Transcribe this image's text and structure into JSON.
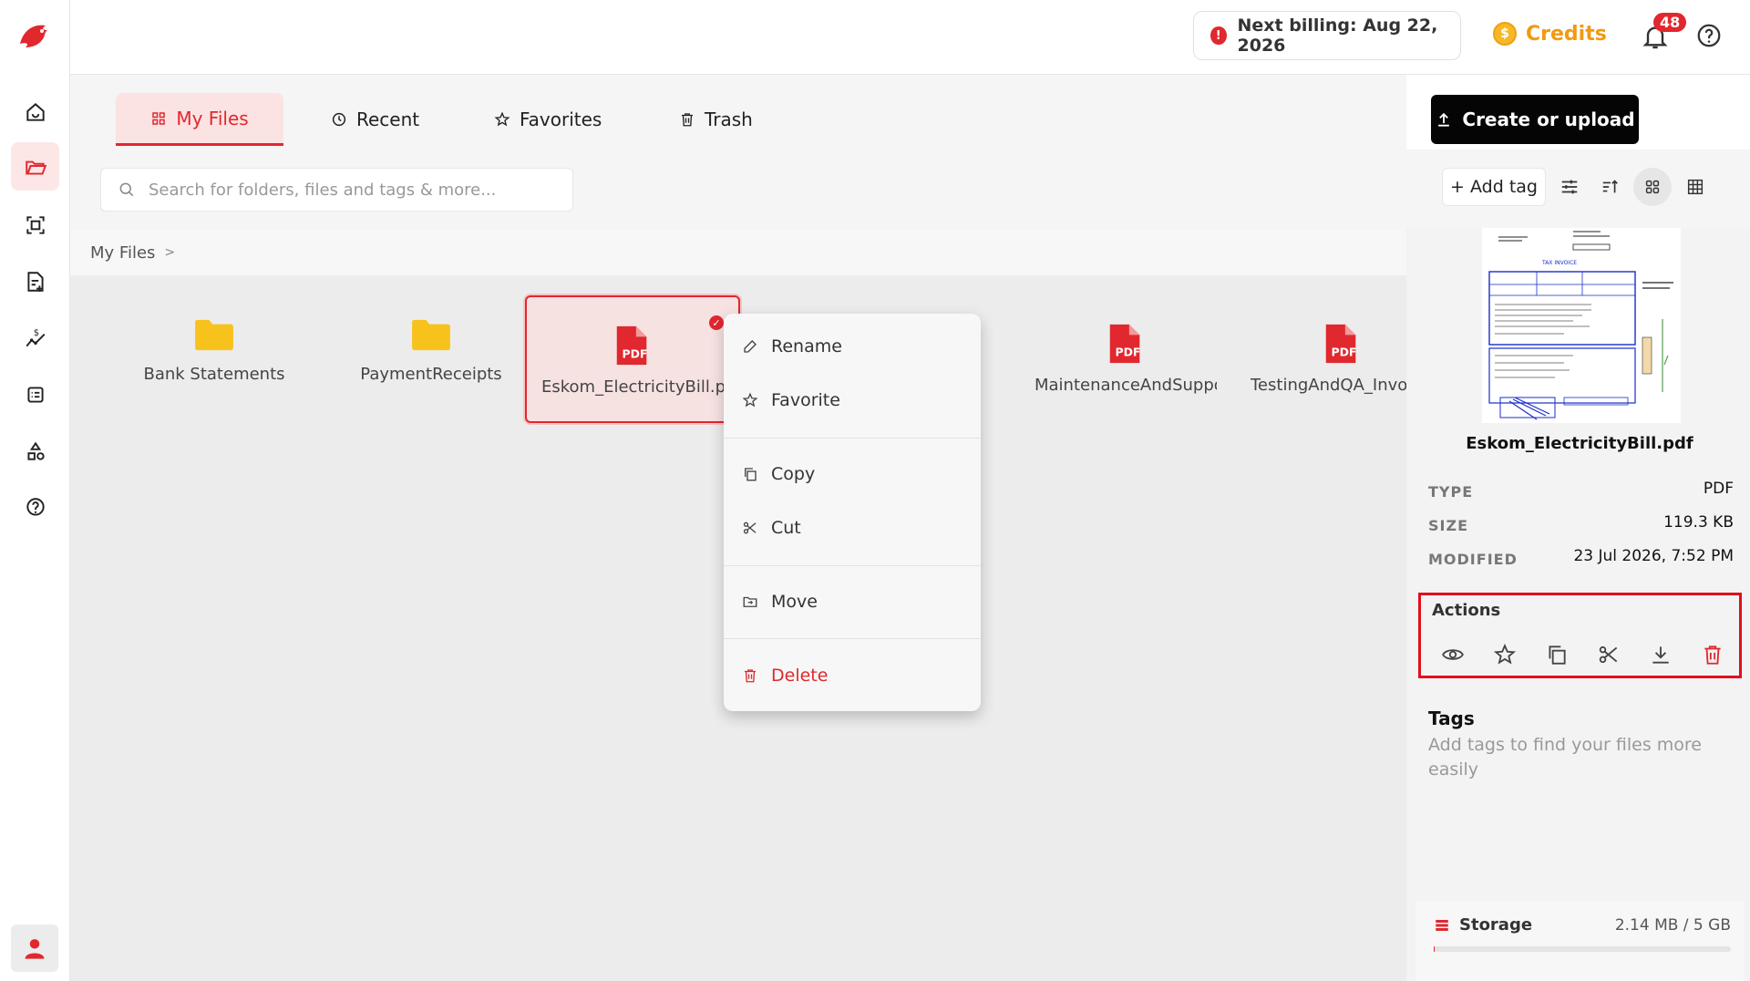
{
  "topbar": {
    "billing_label": "Next billing: Aug 22, 2026",
    "credits_label": "Credits",
    "notification_count": "48"
  },
  "tabs": [
    {
      "label": "My Files",
      "icon": "grid-icon",
      "active": true
    },
    {
      "label": "Recent",
      "icon": "clock-icon",
      "active": false
    },
    {
      "label": "Favorites",
      "icon": "star-icon",
      "active": false
    },
    {
      "label": "Trash",
      "icon": "trash-icon",
      "active": false
    }
  ],
  "create_button_label": "Create or upload",
  "search": {
    "placeholder": "Search for folders, files and tags & more..."
  },
  "toolbar": {
    "add_tag_label": "+ Add tag"
  },
  "breadcrumb": {
    "root": "My Files",
    "separator": ">"
  },
  "files": [
    {
      "name": "Bank Statements",
      "type": "folder"
    },
    {
      "name": "PaymentReceipts",
      "type": "folder"
    },
    {
      "name": "Eskom_ElectricityBill.pdf",
      "type": "pdf",
      "selected": true
    },
    {
      "name": "MaintenanceAndSupport",
      "type": "pdf"
    },
    {
      "name": "TestingAndQA_Invoice.pdf",
      "type": "pdf"
    }
  ],
  "pdf_icon_label": "PDF",
  "context_menu": {
    "rename": "Rename",
    "favorite": "Favorite",
    "copy": "Copy",
    "cut": "Cut",
    "move": "Move",
    "delete": "Delete"
  },
  "details": {
    "file_name": "Eskom_ElectricityBill.pdf",
    "type_label": "TYPE",
    "type_value": "PDF",
    "size_label": "SIZE",
    "size_value": "119.3 KB",
    "modified_label": "MODIFIED",
    "modified_value": "23 Jul 2026, 7:52 PM",
    "actions_title": "Actions",
    "tags_title": "Tags",
    "tags_hint": "Add tags to find your files more easily"
  },
  "storage": {
    "label": "Storage",
    "value": "2.14 MB / 5 GB",
    "used_fraction": 0.0004
  },
  "colors": {
    "accent": "#e0282e",
    "credits": "#f29a12",
    "folder": "#f8c21c",
    "dark_button": "#050505"
  }
}
